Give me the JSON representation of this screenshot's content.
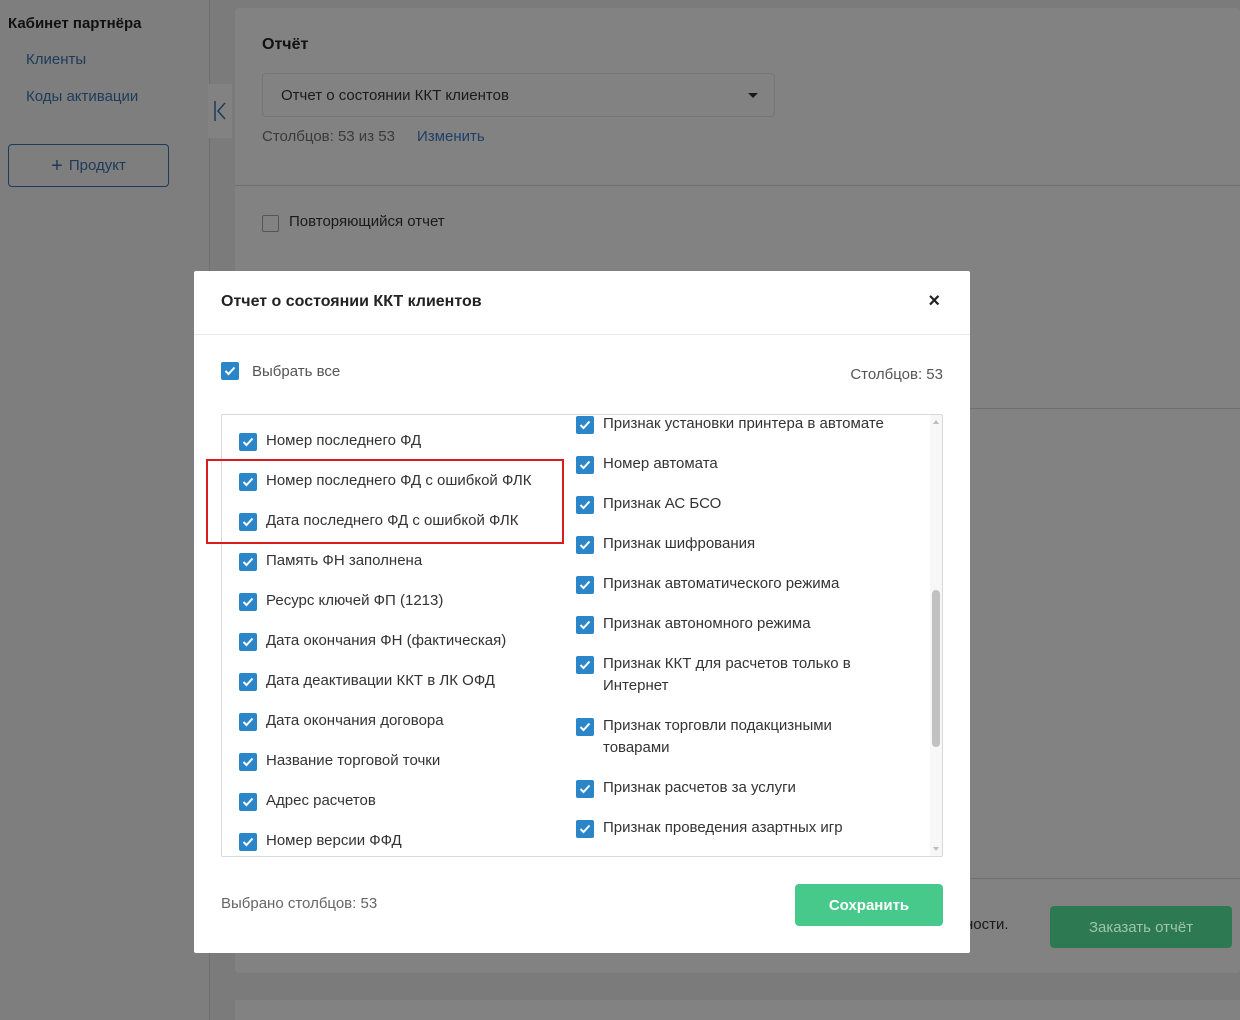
{
  "sidebar": {
    "title": "Кабинет партнёра",
    "items": [
      {
        "label": "Клиенты"
      },
      {
        "label": "Коды активации"
      }
    ],
    "product_button": {
      "icon": "+",
      "label": "Продукт"
    }
  },
  "main": {
    "report_label": "Отчёт",
    "report_select_value": "Отчет о состоянии ККТ клиентов",
    "columns_info": "Столбцов: 53 из 53",
    "change_link": "Изменить",
    "repeat_label": "Повторяющийся отчет",
    "partial_text": "ности.",
    "order_button": "Заказать отчёт"
  },
  "modal": {
    "title": "Отчет о состоянии ККТ клиентов",
    "close_icon": "×",
    "select_all_label": "Выбрать все",
    "columns_count": "Столбцов: 53",
    "left_column": [
      "Номер последнего ФД",
      "Номер последнего ФД с ошибкой ФЛК",
      "Дата последнего ФД с ошибкой ФЛК",
      "Память ФН заполнена",
      "Ресурс ключей ФП (1213)",
      "Дата окончания ФН (фактическая)",
      "Дата деактивации ККТ в ЛК ОФД",
      "Дата окончания договора",
      "Название торговой точки",
      "Адрес расчетов",
      "Номер версии ФФД"
    ],
    "right_column": [
      "Признак установки принтера в автомате",
      "Номер автомата",
      "Признак АС БСО",
      "Признак шифрования",
      "Признак автоматического режима",
      "Признак автономного режима",
      "Признак ККТ для расчетов только в Интернет",
      "Признак торговли подакцизными товарами",
      "Признак расчетов за услуги",
      "Признак проведения азартных игр"
    ],
    "selected_count": "Выбрано столбцов: 53",
    "save_button": "Сохранить"
  },
  "colors": {
    "checkbox": "#2a86c8",
    "save_button": "#47c98b",
    "highlight": "#d91c1c"
  }
}
